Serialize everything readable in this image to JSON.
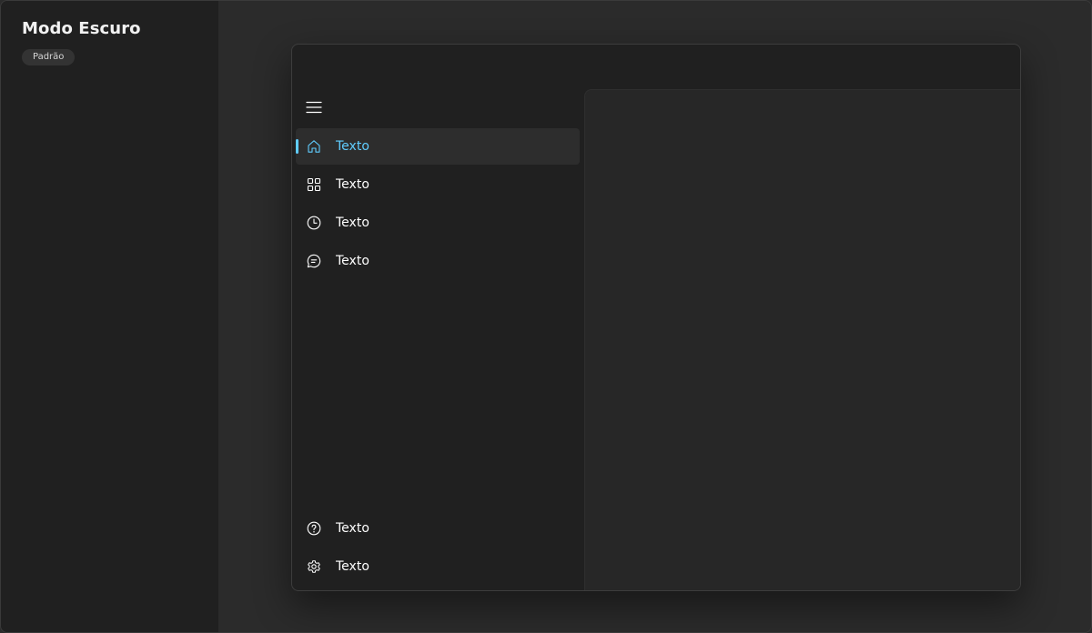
{
  "sidebar": {
    "title": "Modo Escuro",
    "badge": "Padrão"
  },
  "window": {
    "nav": {
      "menu_icon": "hamburger-menu-icon",
      "top_items": [
        {
          "label": "Texto",
          "icon": "home-icon",
          "selected": true
        },
        {
          "label": "Texto",
          "icon": "apps-grid-icon",
          "selected": false
        },
        {
          "label": "Texto",
          "icon": "clock-icon",
          "selected": false
        },
        {
          "label": "Texto",
          "icon": "chat-icon",
          "selected": false
        }
      ],
      "bottom_items": [
        {
          "label": "Texto",
          "icon": "help-icon"
        },
        {
          "label": "Texto",
          "icon": "settings-gear-icon"
        }
      ]
    }
  },
  "colors": {
    "accent": "#60cdff",
    "nav_background": "#202020",
    "content_background": "#272727",
    "selected_background": "#2d2d2d",
    "text": "#ffffff"
  }
}
